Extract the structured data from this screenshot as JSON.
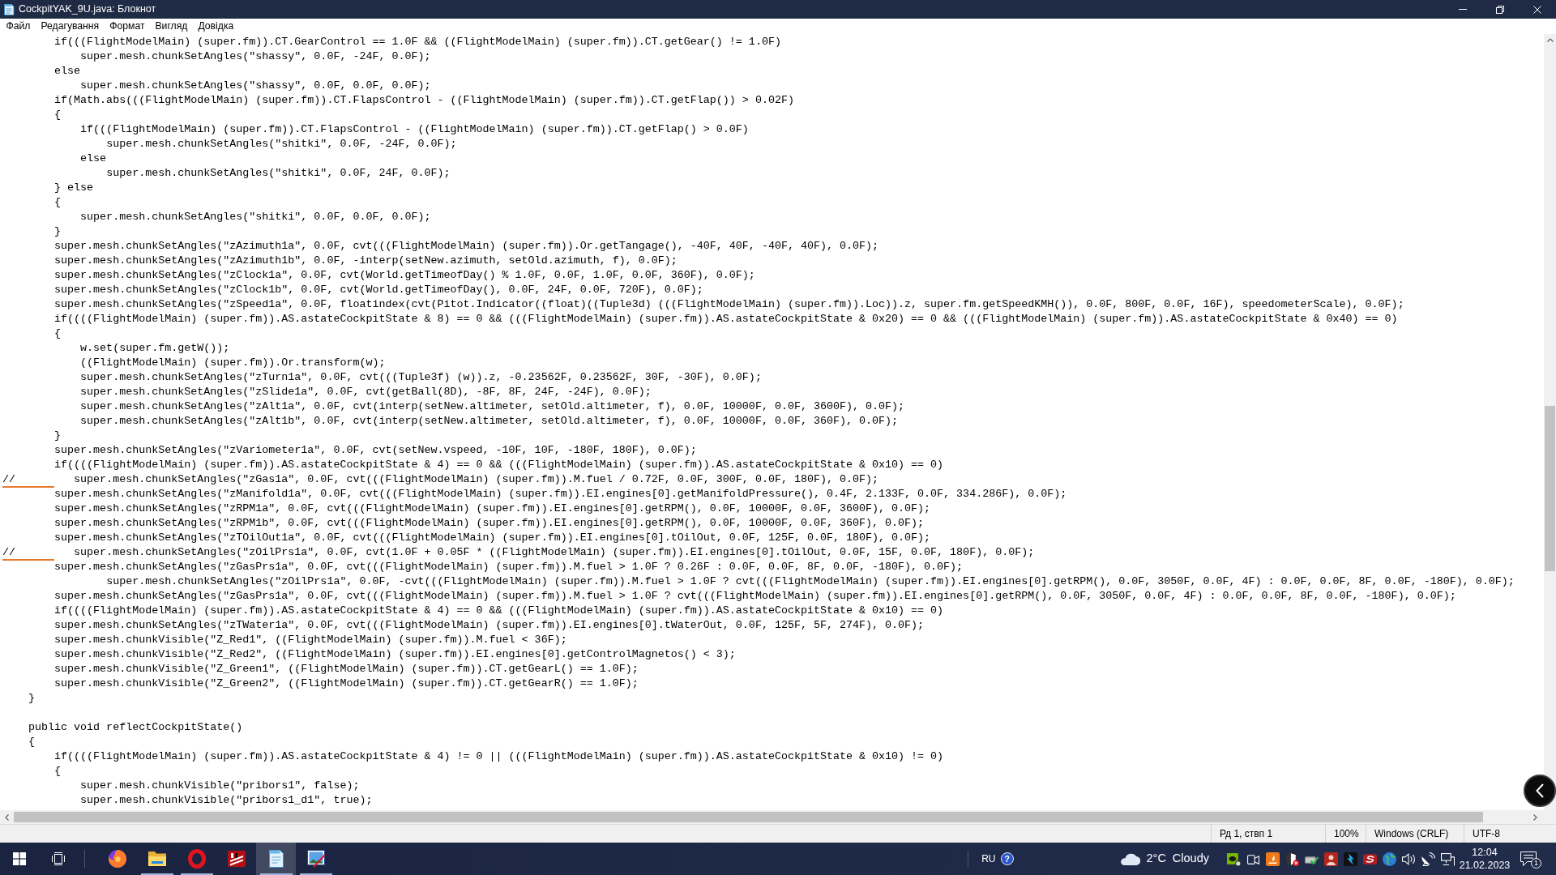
{
  "window": {
    "title": "CockpitYAK_9U.java: Блокнот"
  },
  "menu": [
    "Файл",
    "Редагування",
    "Формат",
    "Вигляд",
    "Довідка"
  ],
  "editor": {
    "lines": [
      {
        "text": "        if(((FlightModelMain) (super.fm)).CT.GearControl == 1.0F && ((FlightModelMain) (super.fm)).CT.getGear() != 1.0F)",
        "underlined": false
      },
      {
        "text": "            super.mesh.chunkSetAngles(\"shassy\", 0.0F, -24F, 0.0F);",
        "underlined": false
      },
      {
        "text": "        else",
        "underlined": false
      },
      {
        "text": "            super.mesh.chunkSetAngles(\"shassy\", 0.0F, 0.0F, 0.0F);",
        "underlined": false
      },
      {
        "text": "        if(Math.abs(((FlightModelMain) (super.fm)).CT.FlapsControl - ((FlightModelMain) (super.fm)).CT.getFlap()) > 0.02F)",
        "underlined": false
      },
      {
        "text": "        {",
        "underlined": false
      },
      {
        "text": "            if(((FlightModelMain) (super.fm)).CT.FlapsControl - ((FlightModelMain) (super.fm)).CT.getFlap() > 0.0F)",
        "underlined": false
      },
      {
        "text": "                super.mesh.chunkSetAngles(\"shitki\", 0.0F, -24F, 0.0F);",
        "underlined": false
      },
      {
        "text": "            else",
        "underlined": false
      },
      {
        "text": "                super.mesh.chunkSetAngles(\"shitki\", 0.0F, 24F, 0.0F);",
        "underlined": false
      },
      {
        "text": "        } else",
        "underlined": false
      },
      {
        "text": "        {",
        "underlined": false
      },
      {
        "text": "            super.mesh.chunkSetAngles(\"shitki\", 0.0F, 0.0F, 0.0F);",
        "underlined": false
      },
      {
        "text": "        }",
        "underlined": false
      },
      {
        "text": "        super.mesh.chunkSetAngles(\"zAzimuth1a\", 0.0F, cvt(((FlightModelMain) (super.fm)).Or.getTangage(), -40F, 40F, -40F, 40F), 0.0F);",
        "underlined": false
      },
      {
        "text": "        super.mesh.chunkSetAngles(\"zAzimuth1b\", 0.0F, -interp(setNew.azimuth, setOld.azimuth, f), 0.0F);",
        "underlined": false
      },
      {
        "text": "        super.mesh.chunkSetAngles(\"zClock1a\", 0.0F, cvt(World.getTimeofDay() % 1.0F, 0.0F, 1.0F, 0.0F, 360F), 0.0F);",
        "underlined": false
      },
      {
        "text": "        super.mesh.chunkSetAngles(\"zClock1b\", 0.0F, cvt(World.getTimeofDay(), 0.0F, 24F, 0.0F, 720F), 0.0F);",
        "underlined": false
      },
      {
        "text": "        super.mesh.chunkSetAngles(\"zSpeed1a\", 0.0F, floatindex(cvt(Pitot.Indicator((float)((Tuple3d) (((FlightModelMain) (super.fm)).Loc)).z, super.fm.getSpeedKMH()), 0.0F, 800F, 0.0F, 16F), speedometerScale), 0.0F);",
        "underlined": false
      },
      {
        "text": "        if((((FlightModelMain) (super.fm)).AS.astateCockpitState & 8) == 0 && (((FlightModelMain) (super.fm)).AS.astateCockpitState & 0x20) == 0 && (((FlightModelMain) (super.fm)).AS.astateCockpitState & 0x40) == 0)",
        "underlined": false
      },
      {
        "text": "        {",
        "underlined": false
      },
      {
        "text": "            w.set(super.fm.getW());",
        "underlined": false
      },
      {
        "text": "            ((FlightModelMain) (super.fm)).Or.transform(w);",
        "underlined": false
      },
      {
        "text": "            super.mesh.chunkSetAngles(\"zTurn1a\", 0.0F, cvt(((Tuple3f) (w)).z, -0.23562F, 0.23562F, 30F, -30F), 0.0F);",
        "underlined": false
      },
      {
        "text": "            super.mesh.chunkSetAngles(\"zSlide1a\", 0.0F, cvt(getBall(8D), -8F, 8F, 24F, -24F), 0.0F);",
        "underlined": false
      },
      {
        "text": "            super.mesh.chunkSetAngles(\"zAlt1a\", 0.0F, cvt(interp(setNew.altimeter, setOld.altimeter, f), 0.0F, 10000F, 0.0F, 3600F), 0.0F);",
        "underlined": false
      },
      {
        "text": "            super.mesh.chunkSetAngles(\"zAlt1b\", 0.0F, cvt(interp(setNew.altimeter, setOld.altimeter, f), 0.0F, 10000F, 0.0F, 360F), 0.0F);",
        "underlined": false
      },
      {
        "text": "        }",
        "underlined": false
      },
      {
        "text": "        super.mesh.chunkSetAngles(\"zVariometer1a\", 0.0F, cvt(setNew.vspeed, -10F, 10F, -180F, 180F), 0.0F);",
        "underlined": false
      },
      {
        "text": "        if((((FlightModelMain) (super.fm)).AS.astateCockpitState & 4) == 0 && (((FlightModelMain) (super.fm)).AS.astateCockpitState & 0x10) == 0)",
        "underlined": false
      },
      {
        "text": "//         super.mesh.chunkSetAngles(\"zGas1a\", 0.0F, cvt(((FlightModelMain) (super.fm)).M.fuel / 0.72F, 0.0F, 300F, 0.0F, 180F), 0.0F);",
        "underlined": true
      },
      {
        "text": "        super.mesh.chunkSetAngles(\"zManifold1a\", 0.0F, cvt(((FlightModelMain) (super.fm)).EI.engines[0].getManifoldPressure(), 0.4F, 2.133F, 0.0F, 334.286F), 0.0F);",
        "underlined": false
      },
      {
        "text": "        super.mesh.chunkSetAngles(\"zRPM1a\", 0.0F, cvt(((FlightModelMain) (super.fm)).EI.engines[0].getRPM(), 0.0F, 10000F, 0.0F, 3600F), 0.0F);",
        "underlined": false
      },
      {
        "text": "        super.mesh.chunkSetAngles(\"zRPM1b\", 0.0F, cvt(((FlightModelMain) (super.fm)).EI.engines[0].getRPM(), 0.0F, 10000F, 0.0F, 360F), 0.0F);",
        "underlined": false
      },
      {
        "text": "        super.mesh.chunkSetAngles(\"zTOilOut1a\", 0.0F, cvt(((FlightModelMain) (super.fm)).EI.engines[0].tOilOut, 0.0F, 125F, 0.0F, 180F), 0.0F);",
        "underlined": false
      },
      {
        "text": "//         super.mesh.chunkSetAngles(\"zOilPrs1a\", 0.0F, cvt(1.0F + 0.05F * ((FlightModelMain) (super.fm)).EI.engines[0].tOilOut, 0.0F, 15F, 0.0F, 180F), 0.0F);",
        "underlined": true
      },
      {
        "text": "        super.mesh.chunkSetAngles(\"zGasPrs1a\", 0.0F, cvt(((FlightModelMain) (super.fm)).M.fuel > 1.0F ? 0.26F : 0.0F, 0.0F, 8F, 0.0F, -180F), 0.0F);",
        "underlined": false
      },
      {
        "text": "                super.mesh.chunkSetAngles(\"zOilPrs1a\", 0.0F, -cvt(((FlightModelMain) (super.fm)).M.fuel > 1.0F ? cvt(((FlightModelMain) (super.fm)).EI.engines[0].getRPM(), 0.0F, 3050F, 0.0F, 4F) : 0.0F, 0.0F, 8F, 0.0F, -180F), 0.0F);",
        "underlined": false
      },
      {
        "text": "        super.mesh.chunkSetAngles(\"zGasPrs1a\", 0.0F, cvt(((FlightModelMain) (super.fm)).M.fuel > 1.0F ? cvt(((FlightModelMain) (super.fm)).EI.engines[0].getRPM(), 0.0F, 3050F, 0.0F, 4F) : 0.0F, 0.0F, 8F, 0.0F, -180F), 0.0F);",
        "underlined": false
      },
      {
        "text": "        if((((FlightModelMain) (super.fm)).AS.astateCockpitState & 4) == 0 && (((FlightModelMain) (super.fm)).AS.astateCockpitState & 0x10) == 0)",
        "underlined": false
      },
      {
        "text": "        super.mesh.chunkSetAngles(\"zTWater1a\", 0.0F, cvt(((FlightModelMain) (super.fm)).EI.engines[0].tWaterOut, 0.0F, 125F, 5F, 274F), 0.0F);",
        "underlined": false
      },
      {
        "text": "        super.mesh.chunkVisible(\"Z_Red1\", ((FlightModelMain) (super.fm)).M.fuel < 36F);",
        "underlined": false
      },
      {
        "text": "        super.mesh.chunkVisible(\"Z_Red2\", ((FlightModelMain) (super.fm)).EI.engines[0].getControlMagnetos() < 3);",
        "underlined": false
      },
      {
        "text": "        super.mesh.chunkVisible(\"Z_Green1\", ((FlightModelMain) (super.fm)).CT.getGearL() == 1.0F);",
        "underlined": false
      },
      {
        "text": "        super.mesh.chunkVisible(\"Z_Green2\", ((FlightModelMain) (super.fm)).CT.getGearR() == 1.0F);",
        "underlined": false
      },
      {
        "text": "    }",
        "underlined": false
      },
      {
        "underlined": false
      },
      {
        "text": "    public void reflectCockpitState()",
        "underlined": false
      },
      {
        "text": "    {",
        "underlined": false
      },
      {
        "text": "        if((((FlightModelMain) (super.fm)).AS.astateCockpitState & 4) != 0 || (((FlightModelMain) (super.fm)).AS.astateCockpitState & 0x10) != 0)",
        "underlined": false
      },
      {
        "text": "        {",
        "underlined": false
      },
      {
        "text": "            super.mesh.chunkVisible(\"pribors1\", false);",
        "underlined": false
      },
      {
        "text": "            super.mesh.chunkVisible(\"pribors1_d1\", true);",
        "underlined": false
      }
    ]
  },
  "status_bar": {
    "position": "Рд 1, ствп 1",
    "zoom": "100%",
    "line_ending": "Windows (CRLF)",
    "encoding": "UTF-8"
  },
  "taskbar": {
    "apps": [
      {
        "kind": "browser",
        "running": false,
        "selected": false
      },
      {
        "kind": "folder",
        "running": true,
        "selected": false
      },
      {
        "kind": "ring",
        "running": true,
        "selected": false
      },
      {
        "kind": "game",
        "running": false,
        "selected": false
      },
      {
        "kind": "notepad",
        "running": true,
        "selected": true
      },
      {
        "kind": "picture",
        "running": true,
        "selected": false
      }
    ],
    "language": "RU",
    "help": "?",
    "weather": {
      "temperature": "2°C",
      "condition": "Cloudy"
    },
    "clock": {
      "time": "12:04",
      "date": "21.02.2023"
    },
    "notifications": {
      "count": "1"
    }
  }
}
